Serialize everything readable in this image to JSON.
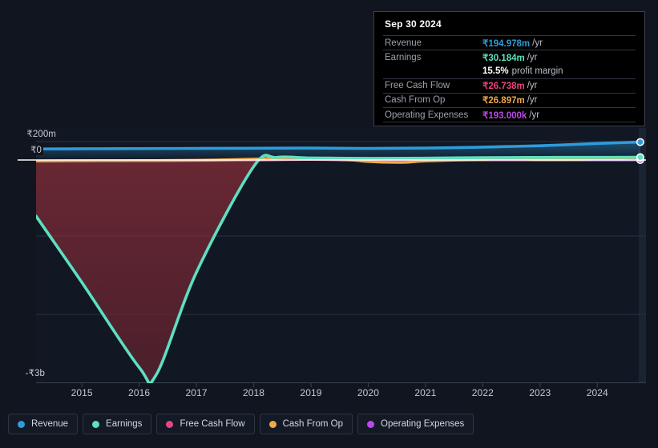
{
  "theme": {
    "background": "#11151f",
    "plot_background": "#121724",
    "gridline": "#2a3140",
    "zero_line": "#ffffff",
    "text": "#c7ccd6"
  },
  "tooltip": {
    "date": "Sep 30 2024",
    "rows": [
      {
        "label": "Revenue",
        "value": "₹194.978m",
        "unit": "/yr",
        "color": "#2d9cdb"
      },
      {
        "label": "Earnings",
        "value": "₹30.184m",
        "unit": "/yr",
        "color": "#5ce0c0"
      },
      {
        "label": "Free Cash Flow",
        "value": "₹26.738m",
        "unit": "/yr",
        "color": "#e8457e"
      },
      {
        "label": "Cash From Op",
        "value": "₹26.897m",
        "unit": "/yr",
        "color": "#efa94a"
      },
      {
        "label": "Operating Expenses",
        "value": "₹193.000k",
        "unit": "/yr",
        "color": "#b94ae8"
      }
    ],
    "margin_value": "15.5%",
    "margin_label": "profit margin"
  },
  "legend": {
    "items": [
      {
        "label": "Revenue",
        "color": "#2d9cdb"
      },
      {
        "label": "Earnings",
        "color": "#5ce0c0"
      },
      {
        "label": "Free Cash Flow",
        "color": "#e8457e"
      },
      {
        "label": "Cash From Op",
        "color": "#efa94a"
      },
      {
        "label": "Operating Expenses",
        "color": "#b94ae8"
      }
    ]
  },
  "chart_data": {
    "type": "line",
    "title": "",
    "xlabel": "",
    "ylabel": "",
    "grid": true,
    "legend_position": "bottom",
    "y_ticks": [
      "₹200m",
      "₹0",
      "-₹3b"
    ],
    "y_tick_values": [
      200000000,
      0,
      -3000000000
    ],
    "ylim": [
      -3300000000,
      330000000
    ],
    "x_ticks": [
      "2015",
      "2016",
      "2017",
      "2018",
      "2019",
      "2020",
      "2021",
      "2022",
      "2023",
      "2024"
    ],
    "xlim": [
      2014.2,
      2024.85
    ],
    "highlight_x": "2024.75",
    "series": [
      {
        "name": "Revenue",
        "color": "#2d9cdb",
        "x": [
          2014.2,
          2015,
          2016,
          2017,
          2018,
          2019,
          2020,
          2021,
          2022,
          2023,
          2024,
          2024.75
        ],
        "values": [
          120000000,
          122000000,
          124000000,
          126000000,
          128000000,
          130000000,
          126000000,
          130000000,
          140000000,
          155000000,
          180000000,
          194978000
        ]
      },
      {
        "name": "Earnings",
        "color": "#5ce0c0",
        "x": [
          2014.2,
          2015,
          2016,
          2016.3,
          2017,
          2018,
          2018.4,
          2019,
          2020,
          2021,
          2022,
          2023,
          2024,
          2024.75
        ],
        "values": [
          -780000000,
          -1700000000,
          -2880000000,
          -2980000000,
          -1560000000,
          -90000000,
          28000000,
          22000000,
          18000000,
          20000000,
          26000000,
          28000000,
          29000000,
          30184000
        ]
      },
      {
        "name": "Free Cash Flow",
        "color": "#e8457e",
        "x": [
          2014.2,
          2015,
          2016,
          2017,
          2018,
          2019,
          2020,
          2021,
          2022,
          2023,
          2024,
          2024.75
        ],
        "values": [
          -14000000,
          -10000000,
          -8000000,
          -6000000,
          -2000000,
          6000000,
          -6000000,
          -2000000,
          6000000,
          4000000,
          16000000,
          26738000
        ]
      },
      {
        "name": "Cash From Op",
        "color": "#efa94a",
        "x": [
          2014.2,
          2015,
          2016,
          2017,
          2018,
          2018.6,
          2019,
          2019.4,
          2020,
          2020.6,
          2021,
          2022,
          2022.6,
          2023,
          2024,
          2024.75
        ],
        "values": [
          -14000000,
          -10000000,
          -8000000,
          -4000000,
          10000000,
          26000000,
          14000000,
          20000000,
          -22000000,
          -34000000,
          -14000000,
          6000000,
          16000000,
          4000000,
          10000000,
          26897000
        ]
      },
      {
        "name": "Operating Expenses",
        "color": "#b94ae8",
        "x": [
          2019.5,
          2020,
          2021,
          2022,
          2023,
          2024,
          2024.75
        ],
        "values": [
          0,
          0,
          0,
          0,
          0,
          0,
          193000
        ]
      }
    ]
  }
}
